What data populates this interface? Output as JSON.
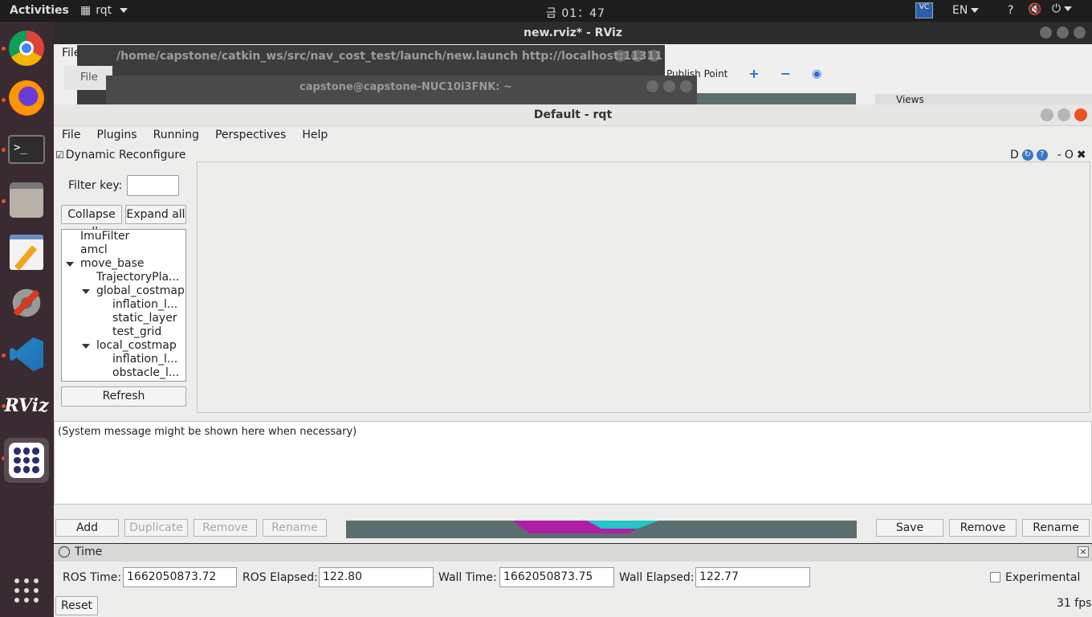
{
  "topbar": {
    "activities": "Activities",
    "app_name": "rqt",
    "clock": "금 01：47",
    "a11y_label": "VC",
    "language": "EN",
    "help_label": "?"
  },
  "rviz": {
    "title": "new.rviz* - RViz",
    "menu_file": "File",
    "publish_point": "Publish Point",
    "views": "Views",
    "bottom_left_buttons": [
      "Add",
      "Duplicate",
      "Remove",
      "Rename"
    ],
    "bottom_right_buttons": [
      "Save",
      "Remove",
      "Rename"
    ]
  },
  "launch_window": {
    "title": "/home/capstone/catkin_ws/src/nav_cost_test/launch/new.launch http://localhost:11311",
    "file_label": "File"
  },
  "terminal_window": {
    "title": "capstone@capstone-NUC10i3FNK: ~"
  },
  "rqt": {
    "title": "Default - rqt",
    "menus": [
      "File",
      "Plugins",
      "Running",
      "Perspectives",
      "Help"
    ],
    "plugin_title": "Dynamic Reconfigure",
    "plugin_controls": {
      "d": "D",
      "help": "?",
      "min": "-",
      "opt": "O",
      "close": "✖"
    },
    "filter_label": "Filter key:",
    "filter_value": "",
    "collapse_all": "Collapse all",
    "expand_all": "Expand all",
    "tree": [
      {
        "label": "ImuFilter",
        "level": 1,
        "expander": false
      },
      {
        "label": "amcl",
        "level": 1,
        "expander": false
      },
      {
        "label": "move_base",
        "level": 1,
        "expander": true
      },
      {
        "label": "TrajectoryPla...",
        "level": 2,
        "expander": false
      },
      {
        "label": "global_costmap",
        "level": 2,
        "expander": true
      },
      {
        "label": "inflation_l...",
        "level": 3,
        "expander": false
      },
      {
        "label": "static_layer",
        "level": 3,
        "expander": false
      },
      {
        "label": "test_grid",
        "level": 3,
        "expander": false
      },
      {
        "label": "local_costmap",
        "level": 2,
        "expander": true
      },
      {
        "label": "inflation_l...",
        "level": 3,
        "expander": false
      },
      {
        "label": "obstacle_l...",
        "level": 3,
        "expander": false
      }
    ],
    "refresh": "Refresh",
    "system_message": "(System message might be shown here when necessary)"
  },
  "time_panel": {
    "title": "Time",
    "ros_time_label": "ROS Time:",
    "ros_time": "1662050873.72",
    "ros_elapsed_label": "ROS Elapsed:",
    "ros_elapsed": "122.80",
    "wall_time_label": "Wall Time:",
    "wall_time": "1662050873.75",
    "wall_elapsed_label": "Wall Elapsed:",
    "wall_elapsed": "122.77",
    "experimental_label": "Experimental",
    "reset": "Reset",
    "fps": "31 fps"
  },
  "colors": {
    "dock_bg": "#3a2b33",
    "accent": "#e95420",
    "costmap_magenta": "#b01ea8",
    "costmap_cyan": "#22c5c8"
  },
  "icons": [
    "chrome-icon",
    "firefox-icon",
    "terminal-icon",
    "files-icon",
    "text-editor-icon",
    "settings-tools-icon",
    "vscode-icon",
    "rviz-icon",
    "rqt-grid-icon",
    "show-apps-icon"
  ]
}
